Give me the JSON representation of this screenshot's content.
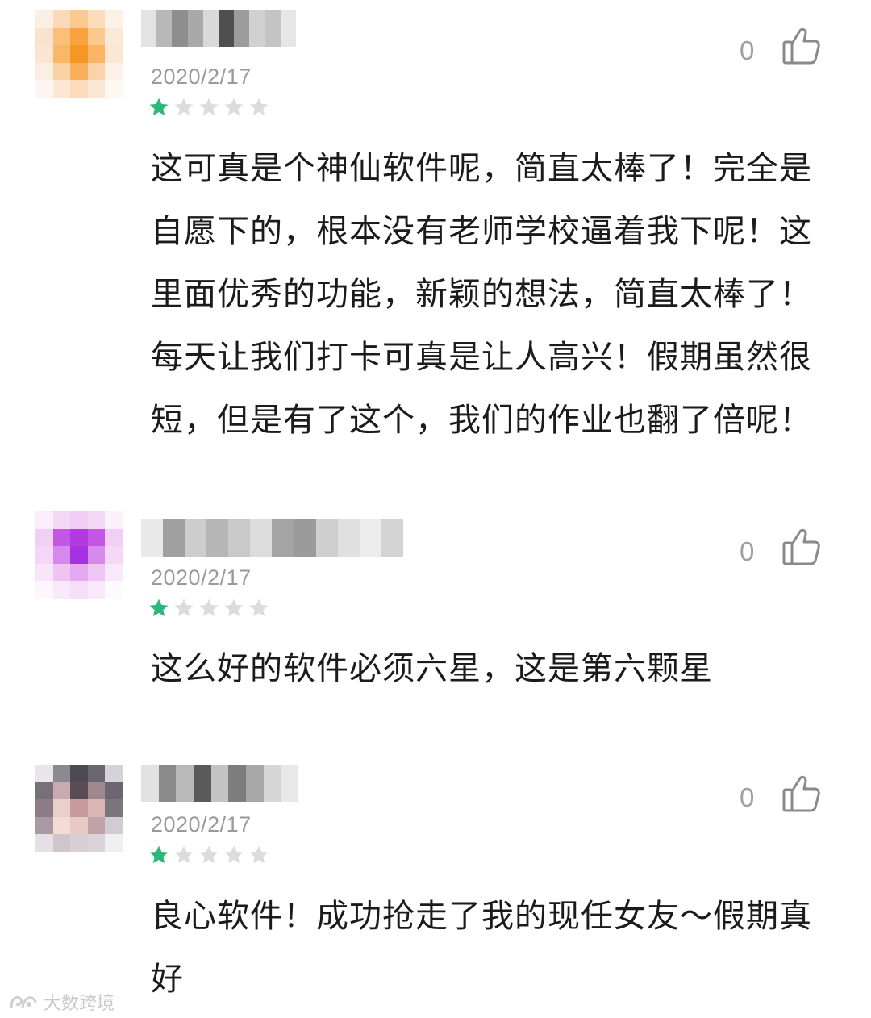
{
  "reviews": [
    {
      "date": "2020/2/17",
      "rating": 1,
      "rating_max": 5,
      "likes": "0",
      "text": "这可真是个神仙软件呢，简直太棒了！完全是\n自愿下的，根本没有老师学校逼着我下呢！这\n里面优秀的功能，新颖的想法，简直太棒了！\n每天让我们打卡可真是让人高兴！假期虽然很\n短，但是有了这个，我们的作业也翻了倍呢！",
      "avatar_colors": [
        "#fbeee3",
        "#fbd9b9",
        "#fcc98f",
        "#fbdcbb",
        "#fdf1e6",
        "#f9e3cd",
        "#fbbf79",
        "#f9a340",
        "#fbc98c",
        "#fbe9d8",
        "#f9e5d1",
        "#f9b867",
        "#f59722",
        "#fab463",
        "#fbe7d4",
        "#fbeee4",
        "#fbd2a6",
        "#f8ae5a",
        "#fbd3a8",
        "#fdf2e8",
        "#fdf5ef",
        "#fbe7d4",
        "#fbdbb9",
        "#fbe7d6",
        "#fef8f3"
      ],
      "name_colors": [
        "#e3e3e3",
        "#b8b8b8",
        "#8e8e8e",
        "#a9a9a9",
        "#d9d9d9",
        "#4f4f4f",
        "#9c9c9c",
        "#d1d1d1",
        "#c4c4c4",
        "#e7e7e7"
      ]
    },
    {
      "date": "2020/2/17",
      "rating": 1,
      "rating_max": 5,
      "likes": "0",
      "text": "这么好的软件必须六星，这是第六颗星",
      "avatar_colors": [
        "#faeefa",
        "#f4d9f6",
        "#f1ccf4",
        "#f4d9f6",
        "#fbf1fb",
        "#f2cff5",
        "#c257e4",
        "#b13ae0",
        "#c356e4",
        "#f2d0f5",
        "#f4d7f6",
        "#d689ec",
        "#a531e0",
        "#d58aec",
        "#f4d8f6",
        "#f8e5f9",
        "#efc4f3",
        "#e4a8f0",
        "#efc5f3",
        "#f9e8fa",
        "#fdf6fd",
        "#f9e7fa",
        "#f6def8",
        "#f9e8fa",
        "#fef9fe"
      ],
      "name_colors": [
        "#e9e9e9",
        "#a0a0a0",
        "#cdcdcd",
        "#b6b6b6",
        "#c9c9c9",
        "#dcdcdc",
        "#a4a4a4",
        "#9b9b9b",
        "#cfcfcf",
        "#e0e0e0",
        "#ececec",
        "#d4d4d4"
      ]
    },
    {
      "date": "2020/2/17",
      "rating": 1,
      "rating_max": 5,
      "likes": "0",
      "text": "良心软件！成功抢走了我的现任女友～假期真\n好",
      "avatar_colors": [
        "#e9e6ea",
        "#8d8990",
        "#4c4a53",
        "#6b6670",
        "#d6d3d8",
        "#77707a",
        "#c8aab0",
        "#5a4c56",
        "#a0888f",
        "#6d6670",
        "#8b7d85",
        "#eacfcb",
        "#c79b9f",
        "#d9b5b4",
        "#7b757d",
        "#a89aa2",
        "#f3dcd4",
        "#e8c9c3",
        "#bfa3a7",
        "#d2ccd2",
        "#e4e0e5",
        "#cfc6cd",
        "#d8d0d6",
        "#d9d4da",
        "#f1eef2"
      ],
      "name_colors": [
        "#e2e2e2",
        "#8a8a8a",
        "#b9b9b9",
        "#5a5a5a",
        "#c3c3c3",
        "#7d7d7d",
        "#a8a8a8",
        "#d6d6d6",
        "#e8e8e8"
      ]
    }
  ],
  "watermark": {
    "text": "大数跨境"
  },
  "colors": {
    "star_filled": "#2db77b",
    "star_empty": "#dcdcdc",
    "like_icon": "#8a8a8a"
  },
  "icons": {
    "like": "thumbs-up-icon",
    "star": "star-icon",
    "watermark_logo": "logo-icon"
  }
}
